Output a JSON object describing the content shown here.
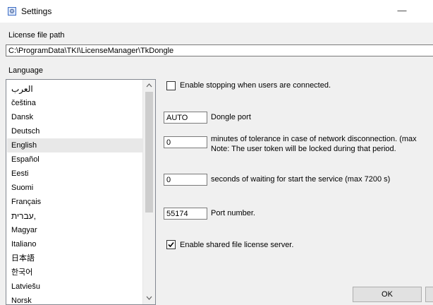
{
  "window": {
    "title": "Settings",
    "minimize_glyph": "—",
    "icon": "gear-icon"
  },
  "license": {
    "label": "License file path",
    "path": "C:\\ProgramData\\TKI\\LicenseManager\\TkDongle"
  },
  "language": {
    "label": "Language",
    "selected": "English",
    "items": [
      "العرب",
      "čeština",
      "Dansk",
      "Deutsch",
      "English",
      "Español",
      "Eesti",
      "Suomi",
      "Français",
      "עברית,",
      "Magyar",
      "Italiano",
      "日本語",
      "한국어",
      "Latviešu",
      "Norsk"
    ]
  },
  "options": {
    "stop_when_users": {
      "label": "Enable stopping when users are connected.",
      "checked": false
    },
    "dongle_port": {
      "value": "AUTO",
      "label": "Dongle port"
    },
    "tolerance": {
      "value": "0",
      "line1": "minutes of tolerance in case of network disconnection. (max",
      "line2": "Note: The user token will be locked during that period."
    },
    "wait": {
      "value": "0",
      "label": "seconds of waiting for start the service (max 7200 s)"
    },
    "port": {
      "value": "55174",
      "label": "Port number."
    },
    "shared_file": {
      "label": "Enable shared file license server.",
      "checked": true
    }
  },
  "buttons": {
    "ok": "OK",
    "cancel": ""
  }
}
